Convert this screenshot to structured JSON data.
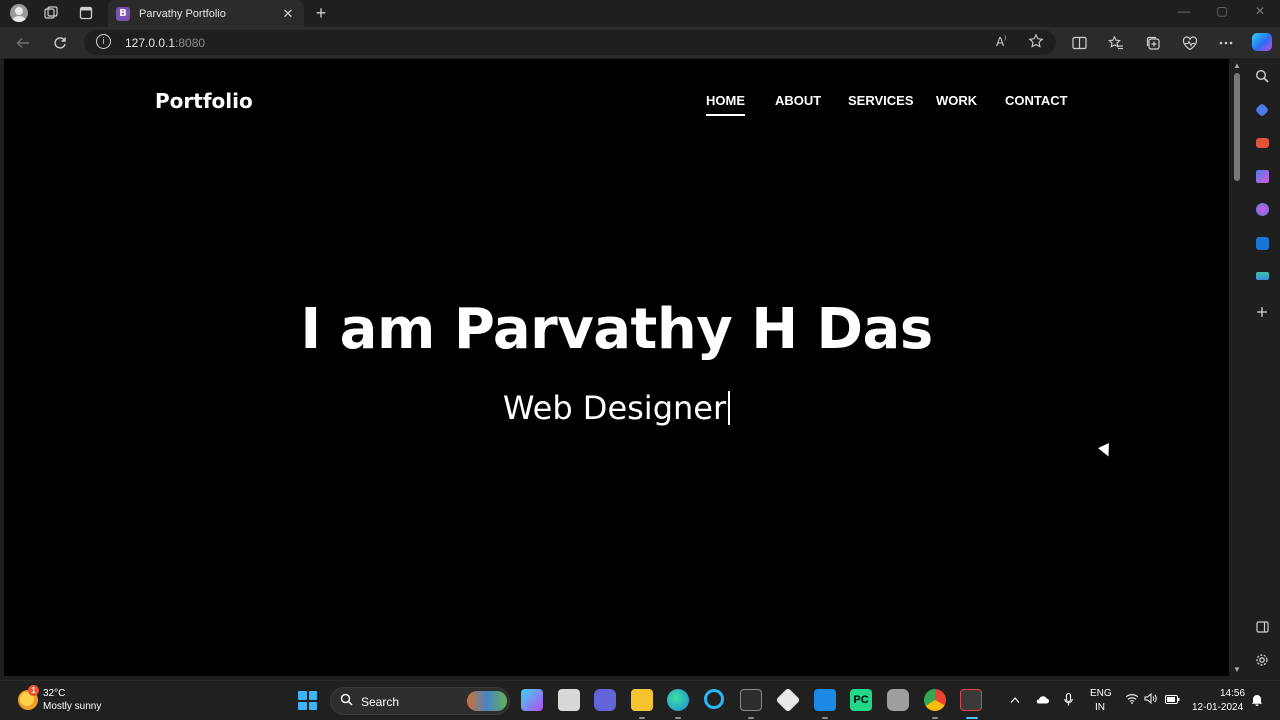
{
  "browser": {
    "tab": {
      "favicon_letter": "B",
      "title": "Parvathy Portfolio",
      "close": "✕"
    },
    "new_tab": "+",
    "window_controls": {
      "minimize": "—",
      "maximize": "▢",
      "close": "✕"
    },
    "address": {
      "host": "127.0.0.1",
      "port": ":8080"
    },
    "icons": [
      "back-icon",
      "refresh-icon",
      "read-aloud-icon",
      "favorite-star-icon",
      "split-screen-icon",
      "favorites-icon",
      "collections-icon",
      "browser-essentials-icon",
      "more-icon",
      "copilot-icon"
    ]
  },
  "page": {
    "brand": "Portfolio",
    "nav": [
      "HOME",
      "ABOUT",
      "SERVICES",
      "WORK",
      "CONTACT"
    ],
    "active_nav": "HOME",
    "hero_title": "I am Parvathy H Das",
    "hero_subtitle": "Web Designer"
  },
  "sidebar": {
    "icons": [
      "search-icon",
      "shopping-icon",
      "tools-icon",
      "games-icon",
      "office-icon",
      "outlook-icon",
      "drop-icon",
      "add-icon",
      "sidebar-toggle-icon",
      "settings-icon"
    ]
  },
  "taskbar": {
    "weather": {
      "badge": "1",
      "temp": "32°C",
      "desc": "Mostly sunny"
    },
    "search_label": "Search",
    "apps": [
      "copilot-app",
      "file-explorer-app",
      "teams-app",
      "folder-app",
      "edge-app",
      "cortana-app",
      "terminal-app",
      "git-app",
      "vscode-app",
      "pycharm-app",
      "database-app",
      "chrome-app",
      "snipping-app"
    ],
    "tray": {
      "lang_top": "ENG",
      "lang_bottom": "IN",
      "time": "14:56",
      "date": "12-01-2024"
    }
  },
  "colors": {
    "page_bg": "#000000",
    "chrome_bg": "#1f1f1f",
    "toolbar_bg": "#2b2b2b",
    "taskbar_bg": "#202020",
    "accent_blue": "#3fb4f5"
  }
}
